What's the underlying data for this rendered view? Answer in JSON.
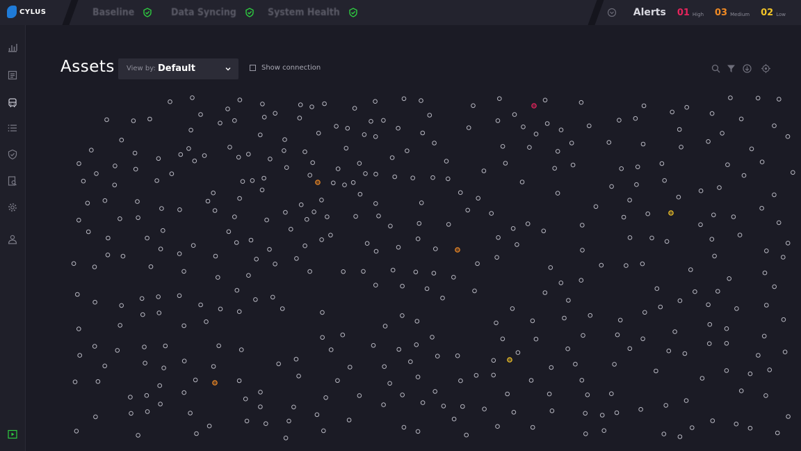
{
  "app": {
    "brand": "CYLUS"
  },
  "topbar": {
    "statuses": [
      {
        "label": "Baseline",
        "state": "ok"
      },
      {
        "label": "Data Syncing",
        "state": "ok"
      },
      {
        "label": "System Health",
        "state": "ok"
      }
    ],
    "alerts": {
      "title": "Alerts",
      "high": {
        "count": "01",
        "label": "High",
        "color": "#e5245c"
      },
      "medium": {
        "count": "03",
        "label": "Medium",
        "color": "#f08a24"
      },
      "low": {
        "count": "02",
        "label": "Low",
        "color": "#f2c428"
      }
    }
  },
  "sidebar": {
    "icons": [
      "chart-icon",
      "list-icon",
      "train-icon",
      "bullet-list-icon",
      "shield-check-icon",
      "search-doc-icon",
      "gear-icon",
      "user-icon",
      "play-icon"
    ]
  },
  "main": {
    "title": "Assets",
    "view_by": {
      "label": "View by:",
      "value": "Default"
    },
    "show_connection": "Show connection",
    "tools": [
      "search-icon",
      "filter-icon",
      "download-icon",
      "target-icon"
    ]
  },
  "colors": {
    "ok": "#2ecc40",
    "node": "#b8b8c2",
    "high": "#e5245c",
    "medium": "#f08a24",
    "low": "#f2c428"
  },
  "graph": {
    "total_nodes": 420,
    "highlighted": [
      {
        "severity": "high"
      },
      {
        "severity": "medium"
      },
      {
        "severity": "medium"
      },
      {
        "severity": "medium"
      },
      {
        "severity": "low"
      },
      {
        "severity": "low"
      }
    ]
  }
}
